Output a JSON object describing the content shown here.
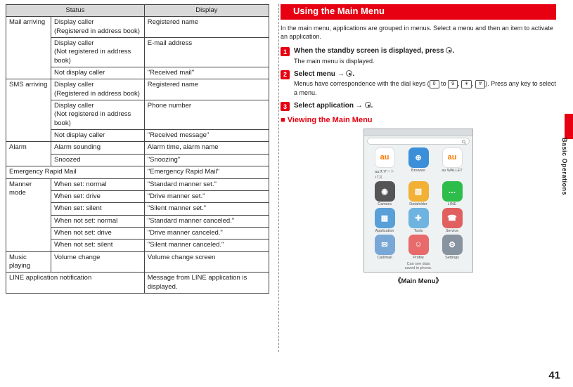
{
  "page_number": "41",
  "side_label": "Basic Operations",
  "table": {
    "head_status": "Status",
    "head_display": "Display",
    "rows": [
      {
        "cat": "Mail arriving",
        "status": "Display caller\n(Registered in address book)",
        "display": "Registered name",
        "rowspan": 3
      },
      {
        "status": "Display caller\n(Not registered in address book)",
        "display": "E-mail address"
      },
      {
        "status": "Not display caller",
        "display": "\"Received mail\""
      },
      {
        "cat": "SMS arriving",
        "status": "Display caller\n(Registered in address book)",
        "display": "Registered name",
        "rowspan": 3
      },
      {
        "status": "Display caller\n(Not registered in address book)",
        "display": "Phone number"
      },
      {
        "status": "Not display caller",
        "display": "\"Received message\""
      },
      {
        "cat": "Alarm",
        "status": "Alarm sounding",
        "display": "Alarm time, alarm name",
        "rowspan": 2
      },
      {
        "status": "Snoozed",
        "display": "\"Snoozing\""
      },
      {
        "full": "Emergency Rapid Mail",
        "display": "\"Emergency Rapid Mail\""
      },
      {
        "cat": "Manner mode",
        "status": "When set: normal",
        "display": "\"Standard manner set.\"",
        "rowspan": 6
      },
      {
        "status": "When set: drive",
        "display": "\"Drive manner set.\""
      },
      {
        "status": "When set: silent",
        "display": "\"Silent manner set.\""
      },
      {
        "status": "When not set: normal",
        "display": "\"Standard manner canceled.\""
      },
      {
        "status": "When not set: drive",
        "display": "\"Drive manner canceled.\""
      },
      {
        "status": "When not set: silent",
        "display": "\"Silent manner canceled.\""
      },
      {
        "cat": "Music playing",
        "status": "Volume change",
        "display": "Volume change screen",
        "rowspan": 1
      },
      {
        "full": "LINE application notification",
        "display": "Message from LINE application is displayed."
      }
    ]
  },
  "section_title": "Using the Main Menu",
  "intro": "In the main menu, applications are grouped in menus. Select a menu and then an item to activate an application.",
  "steps": [
    {
      "n": "1",
      "title_pre": "When the standby screen is displayed, press ",
      "title_post": ".",
      "body": "The main menu is displayed."
    },
    {
      "n": "2",
      "title_pre": "Select menu → ",
      "title_post": ".",
      "body_pre": "Menus have correspondence with the dial keys (",
      "body_mid": " to ",
      "body_post": "). Press any key to select a menu.",
      "k0": "0",
      "k9": "9",
      "kstar": "＊",
      "khash": "#"
    },
    {
      "n": "3",
      "title_pre": "Select application → ",
      "title_post": ".",
      "body": ""
    }
  ],
  "subheading": "Viewing the Main Menu",
  "apps": [
    {
      "label": "auスマート\nパス",
      "bg": "#fff",
      "fg": "#ff7a00",
      "txt": "au"
    },
    {
      "label": "Browser",
      "bg": "#3b8ed8",
      "fg": "#fff",
      "txt": "⊕"
    },
    {
      "label": "au WALLET",
      "bg": "#fff",
      "fg": "#ff7a00",
      "txt": "au"
    },
    {
      "label": "Camera",
      "bg": "#555",
      "fg": "#fff",
      "txt": "◉"
    },
    {
      "label": "Datafolder",
      "bg": "#f2b134",
      "fg": "#fff",
      "txt": "▧"
    },
    {
      "label": "LINE",
      "bg": "#2dbd4b",
      "fg": "#fff",
      "txt": "…"
    },
    {
      "label": "Application",
      "bg": "#5aa0d8",
      "fg": "#fff",
      "txt": "▦"
    },
    {
      "label": "Tools",
      "bg": "#6fb3e0",
      "fg": "#fff",
      "txt": "✚"
    },
    {
      "label": "Service",
      "bg": "#e06060",
      "fg": "#fff",
      "txt": "☎"
    },
    {
      "label": "Call/mail",
      "bg": "#7aa8d6",
      "fg": "#fff",
      "txt": "✉"
    },
    {
      "label": "Profile",
      "bg": "#e86a6a",
      "fg": "#fff",
      "txt": "☺"
    },
    {
      "label": "Settings",
      "bg": "#8893a0",
      "fg": "#fff",
      "txt": "⚙"
    }
  ],
  "dock_msg_l1": "Can see data",
  "dock_msg_l2": "saved in phone.",
  "caption": "《Main Menu》"
}
